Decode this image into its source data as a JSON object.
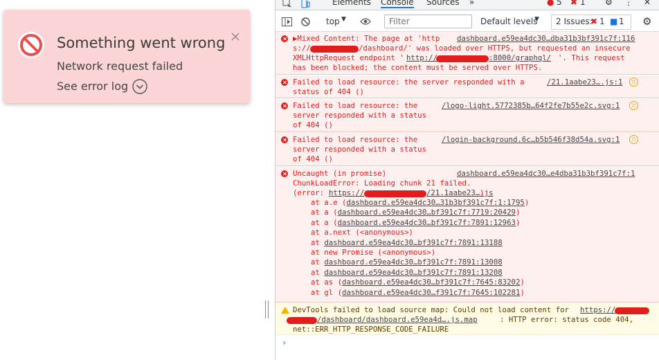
{
  "toast": {
    "title": "Something went wrong",
    "subtitle": "Network request failed",
    "link": "See error log",
    "icon": "error-circle-icon",
    "close_icon": "close-icon",
    "chevron_icon": "chevron-down-circle-icon"
  },
  "devtools": {
    "tabs": [
      "Elements",
      "Console",
      "Sources"
    ],
    "more_tabs": "»",
    "warn_count": "5",
    "error_count": "1",
    "toolbar": {
      "context": "top",
      "filter_placeholder": "Filter",
      "levels": "Default levels",
      "issues_label": "2 Issues:",
      "issues_err": "1",
      "issues_info": "1"
    }
  },
  "console": {
    "messages": [
      {
        "type": "error",
        "lines": [
          "▶Mixed Content: The page at 'http",
          "s://",
          "/dashboard/' was loaded over HTTPS, but requested an insecure",
          "XMLHttpRequest endpoint '",
          "http://",
          ":8000/graphql/",
          "'. This request",
          "has been blocked; the content must be served over HTTPS."
        ],
        "source": "dashboard.e59ea4dc30…dba31b3bf391c7f:116"
      },
      {
        "type": "error",
        "lines": [
          "Failed to load resource: the server responded with a",
          "status of 404 ()"
        ],
        "source": "/21.1aabe23….js:1"
      },
      {
        "type": "error",
        "lines": [
          "Failed to load resource: the",
          "server responded with a status",
          "of 404 ()"
        ],
        "source": "/logo-light.5772385b…64f2fe7b55e2c.svg:1"
      },
      {
        "type": "error",
        "lines": [
          "Failed to load resource: the",
          "server responded with a status",
          "of 404 ()"
        ],
        "source": "/login-background.6c…b5b546f38d54a.svg:1"
      },
      {
        "type": "error",
        "lines": [
          "Uncaught (in promise)",
          "ChunkLoadError: Loading chunk 21 failed.",
          "(error: ",
          "https://",
          "/21.1aabe23….js",
          ")"
        ],
        "source": "dashboard.e59ea4dc30…e4dba31b3bf391c7f:1",
        "stack": [
          {
            "fn": "at a.e (",
            "loc": "dashboard.e59ea4dc30…31b3bf391c7f:1:1795",
            "end": ")"
          },
          {
            "fn": "at a (",
            "loc": "dashboard.e59ea4dc30…bf391c7f:7719:20429",
            "end": ")"
          },
          {
            "fn": "at a (",
            "loc": "dashboard.e59ea4dc30…bf391c7f:7891:12963",
            "end": ")"
          },
          {
            "fn": "at a.next (<anonymous>)",
            "loc": "",
            "end": ""
          },
          {
            "fn": "at ",
            "loc": "dashboard.e59ea4dc30…bf391c7f:7891:13188",
            "end": ""
          },
          {
            "fn": "at new Promise (<anonymous>)",
            "loc": "",
            "end": ""
          },
          {
            "fn": "at ",
            "loc": "dashboard.e59ea4dc30…bf391c7f:7891:13008",
            "end": ""
          },
          {
            "fn": "at ",
            "loc": "dashboard.e59ea4dc30…bf391c7f:7891:13208",
            "end": ""
          },
          {
            "fn": "at as (",
            "loc": "dashboard.e59ea4dc30…bf391c7f:7645:83202",
            "end": ")"
          },
          {
            "fn": "at gl (",
            "loc": "dashboard.e59ea4dc30…f391c7f:7645:102281",
            "end": ")"
          }
        ]
      },
      {
        "type": "warning",
        "lines": [
          "DevTools failed to load source map: Could not load content for ",
          "https://",
          "/dashboard/dashboard.e59ea4d….js.map",
          ": HTTP error: status code 404,",
          "net::ERR_HTTP_RESPONSE_CODE_FAILURE"
        ]
      }
    ],
    "prompt": "›"
  }
}
